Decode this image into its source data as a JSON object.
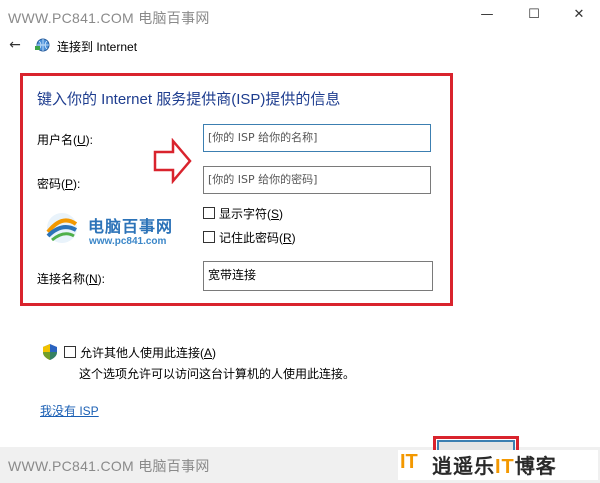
{
  "watermark_top": "WWW.PC841.COM 电脑百事网",
  "window": {
    "minimize": "—",
    "maximize": "☐",
    "close": "✕"
  },
  "nav": {
    "back": "←",
    "title": "连接到 Internet"
  },
  "form": {
    "heading": "键入你的 Internet 服务提供商(ISP)提供的信息",
    "username": {
      "label": "用户名(",
      "key": "U",
      "suffix": "):",
      "placeholder": "[你的 ISP 给你的名称]"
    },
    "password": {
      "label": "密码(",
      "key": "P",
      "suffix": "):",
      "placeholder": "[你的 ISP 给你的密码]"
    },
    "show_chars": {
      "label": "显示字符(",
      "key": "S",
      "suffix": ")",
      "checked": false
    },
    "remember": {
      "label": "记住此密码(",
      "key": "R",
      "suffix": ")",
      "checked": false
    },
    "conn_name": {
      "label": "连接名称(",
      "key": "N",
      "suffix": "):",
      "value": "宽带连接"
    }
  },
  "watermark_logo": {
    "text": "电脑百事网",
    "url": "www.pc841.com"
  },
  "permission": {
    "label": "允许其他人使用此连接(",
    "key": "A",
    "suffix": ")",
    "checked": false,
    "description": "这个选项允许可以访问这台计算机的人使用此连接。"
  },
  "no_isp_link": "我没有 ISP",
  "watermark_bottom": "WWW.PC841.COM 电脑百事网",
  "brand": {
    "it": "IT",
    "name": "逍遥乐",
    "it2": "IT",
    "suffix": "博客"
  },
  "colors": {
    "accent_red": "#d9232d",
    "heading_blue": "#1e3d8f",
    "link_blue": "#1a5fb4",
    "brand_orange": "#f39800"
  }
}
